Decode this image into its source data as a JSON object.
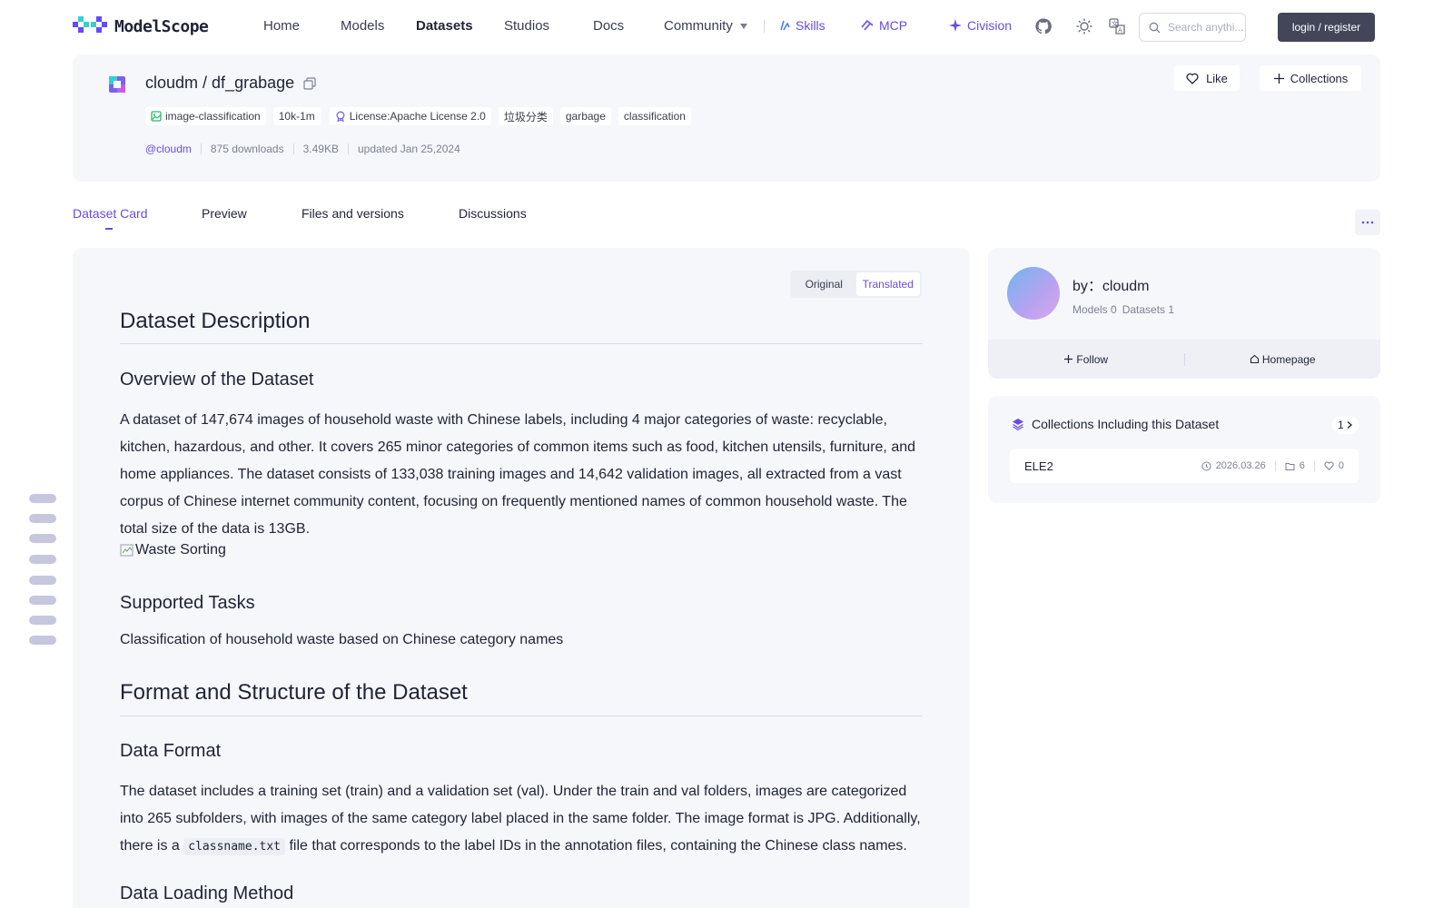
{
  "brand": {
    "name": "ModelScope"
  },
  "nav": {
    "items": [
      {
        "label": "Home"
      },
      {
        "label": "Models"
      },
      {
        "label": "Datasets"
      },
      {
        "label": "Studios"
      },
      {
        "label": "Docs"
      },
      {
        "label": "Community"
      }
    ],
    "skills": "Skills",
    "mcp": "MCP",
    "civision": "Civision",
    "search_placeholder": "Search anythi...",
    "login_label": "login / register"
  },
  "dataset": {
    "owner": "cloudm",
    "separator": "/",
    "name": "df_grabage",
    "tags": [
      "image-classification",
      "10k-1m",
      "License:Apache License 2.0",
      "垃圾分类",
      "garbage",
      "classification"
    ],
    "author": "@cloudm",
    "downloads": "875 downloads",
    "size": "3.49KB",
    "updated": "updated Jan 25,2024",
    "like_label": "Like",
    "collections_label": "Collections"
  },
  "tabs": [
    {
      "label": "Dataset Card"
    },
    {
      "label": "Preview"
    },
    {
      "label": "Files and versions"
    },
    {
      "label": "Discussions"
    }
  ],
  "toggle": {
    "original": "Original",
    "translated": "Translated"
  },
  "doc": {
    "h1_description": "Dataset Description",
    "h2_overview": "Overview of the Dataset",
    "overview_text": "A dataset of 147,674 images of household waste with Chinese labels, including 4 major categories of waste: recyclable, kitchen, hazardous, and other. It covers 265 minor categories of common items such as food, kitchen utensils, furniture, and home appliances. The dataset consists of 133,038 training images and 14,642 validation images, all extracted from a vast corpus of Chinese internet community content, focusing on frequently mentioned names of common household waste. The total size of the data is 13GB.",
    "image_alt": "Waste Sorting",
    "h2_tasks": "Supported Tasks",
    "tasks_text": "Classification of household waste based on Chinese category names",
    "h1_format": "Format and Structure of the Dataset",
    "h2_data_format": "Data Format",
    "format_text_before": "The dataset includes a training set (train) and a validation set (val). Under the train and val folders, images are categorized into 265 subfolders, with images of the same category label placed in the same folder. The image format is JPG. Additionally, there is a ",
    "format_code": "classname.txt",
    "format_text_after": " file that corresponds to the label IDs in the annotation files, containing the Chinese class names.",
    "h2_loading": "Data Loading Method"
  },
  "owner_card": {
    "by_label": "by：cloudm",
    "models": "Models 0",
    "datasets": "Datasets 1",
    "follow": "Follow",
    "homepage": "Homepage"
  },
  "collections_card": {
    "title": "Collections Including this Dataset",
    "count": "1",
    "item": {
      "name": "ELE2",
      "date": "2026.03.26",
      "items": "6",
      "likes": "0"
    }
  },
  "colors": {
    "accent": "#6a4ce0",
    "panel": "#f6f7fb",
    "text": "#1f2335",
    "muted": "#7d8093",
    "login_bg": "#434658"
  }
}
